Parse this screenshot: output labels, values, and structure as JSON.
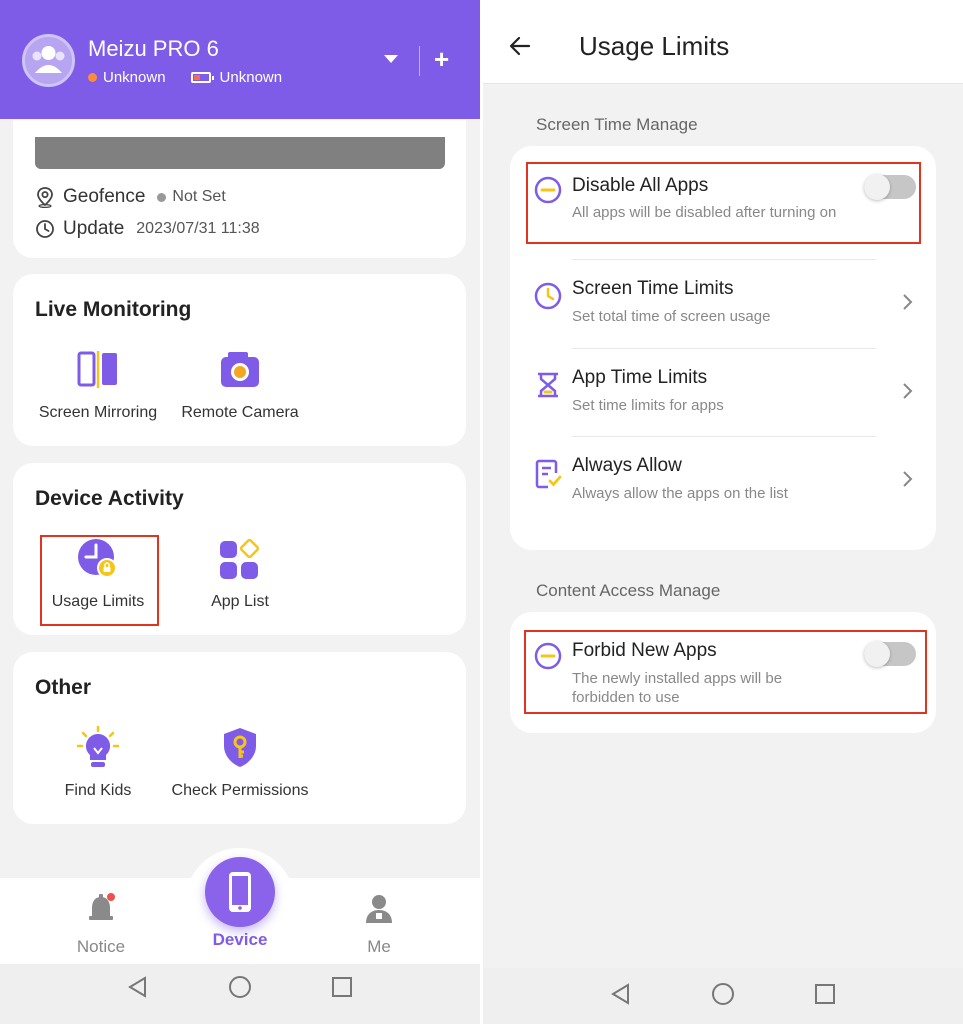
{
  "left": {
    "header": {
      "device_name": "Meizu PRO 6",
      "online_status": "Unknown",
      "battery_status": "Unknown",
      "color": "#7e5ce8"
    },
    "device_info": {
      "geofence_label": "Geofence",
      "geofence_value": "Not Set",
      "update_label": "Update",
      "update_value": "2023/07/31 11:38"
    },
    "live_monitoring": {
      "title": "Live Monitoring",
      "items": [
        {
          "label": "Screen Mirroring",
          "icon": "screen-mirroring-icon"
        },
        {
          "label": "Remote Camera",
          "icon": "camera-icon"
        }
      ]
    },
    "device_activity": {
      "title": "Device Activity",
      "items": [
        {
          "label": "Usage Limits",
          "icon": "usage-limits-icon",
          "highlighted": true
        },
        {
          "label": "App List",
          "icon": "app-list-icon"
        }
      ]
    },
    "other": {
      "title": "Other",
      "items": [
        {
          "label": "Find Kids",
          "icon": "lightbulb-icon"
        },
        {
          "label": "Check Permissions",
          "icon": "shield-key-icon"
        }
      ]
    },
    "bottom_nav": {
      "items": [
        {
          "label": "Notice",
          "icon": "bell-icon",
          "badge": true
        },
        {
          "label": "Device",
          "icon": "phone-icon",
          "active": true
        },
        {
          "label": "Me",
          "icon": "person-icon"
        }
      ]
    }
  },
  "right": {
    "title": "Usage Limits",
    "screen_time_section": {
      "label": "Screen Time Manage",
      "rows": [
        {
          "title": "Disable All Apps",
          "subtitle": "All apps will be disabled after turning on",
          "control": "toggle",
          "toggle_on": false,
          "icon": "minus-circle-icon",
          "highlighted": true
        },
        {
          "title": "Screen Time Limits",
          "subtitle": "Set total time of screen usage",
          "control": "chevron",
          "icon": "clock-icon"
        },
        {
          "title": "App Time Limits",
          "subtitle": "Set time limits for apps",
          "control": "chevron",
          "icon": "hourglass-icon"
        },
        {
          "title": "Always Allow",
          "subtitle": "Always allow the apps on the list",
          "control": "chevron",
          "icon": "checklist-icon"
        }
      ]
    },
    "content_access_section": {
      "label": "Content Access Manage",
      "rows": [
        {
          "title": "Forbid New Apps",
          "subtitle": "The newly installed apps will be forbidden to use",
          "control": "toggle",
          "toggle_on": false,
          "icon": "minus-circle-icon",
          "highlighted": true
        }
      ]
    }
  },
  "colors": {
    "accent": "#7e5ce8",
    "highlight_border": "#e0341e",
    "icon_yellow": "#f5c518"
  }
}
